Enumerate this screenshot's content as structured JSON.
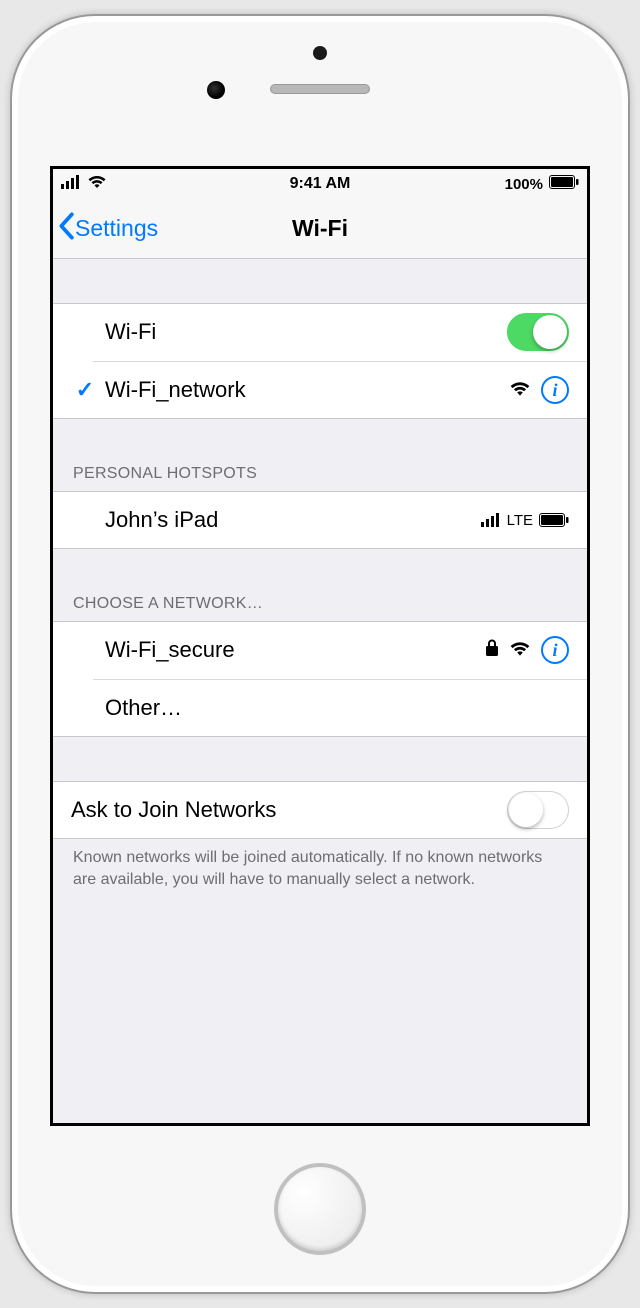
{
  "status": {
    "time": "9:41 AM",
    "battery_text": "100%"
  },
  "nav": {
    "back_label": "Settings",
    "title": "Wi-Fi"
  },
  "wifi": {
    "toggle_label": "Wi-Fi",
    "toggle_on": true,
    "connected_network": "Wi-Fi_network"
  },
  "hotspots": {
    "header": "PERSONAL HOTSPOTS",
    "items": [
      {
        "name": "John’s iPad",
        "status": "LTE"
      }
    ]
  },
  "networks": {
    "header": "CHOOSE A NETWORK…",
    "items": [
      {
        "name": "Wi-Fi_secure",
        "locked": true
      }
    ],
    "other_label": "Other…"
  },
  "ask_to_join": {
    "label": "Ask to Join Networks",
    "on": false,
    "footer": "Known networks will be joined automatically. If no known networks are available, you will have to manually select a network."
  }
}
